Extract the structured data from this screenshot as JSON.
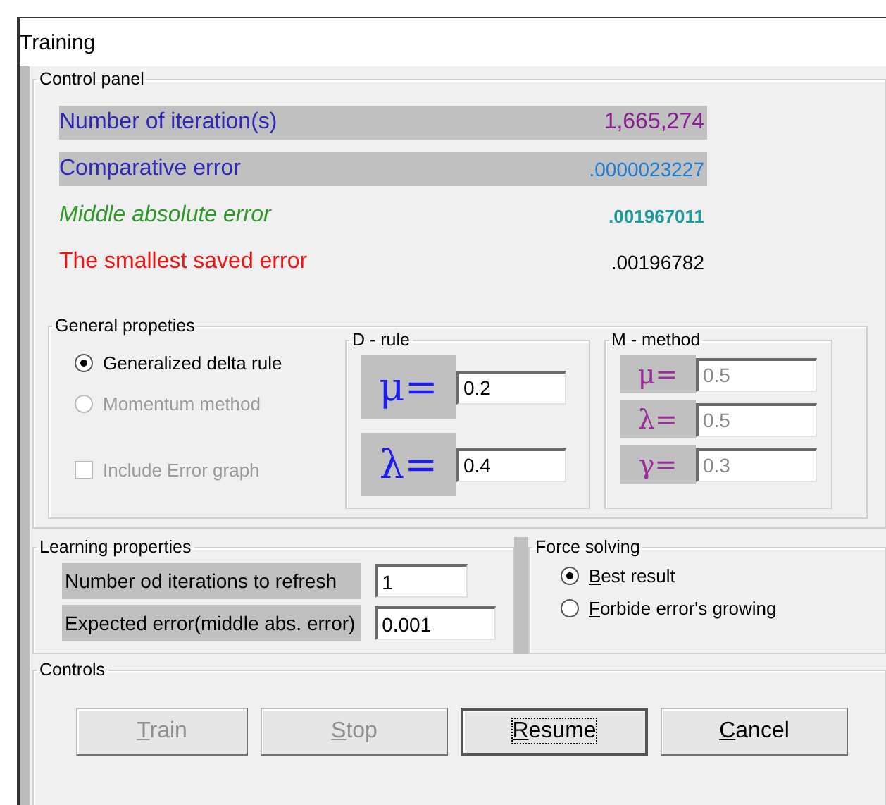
{
  "window": {
    "title": "Training"
  },
  "control_panel": {
    "title": "Control panel",
    "rows": [
      {
        "kind": "iterations",
        "label": "Number of iteration(s)",
        "value": "1,665,274"
      },
      {
        "kind": "comparative",
        "label": "Comparative error",
        "value": ".0000023227"
      },
      {
        "kind": "middle",
        "label": "Middle absolute error",
        "value": ".001967011"
      },
      {
        "kind": "smallest",
        "label": "The smallest saved error",
        "value": ".00196782"
      }
    ]
  },
  "general_properties": {
    "title": "General propeties",
    "options": [
      {
        "label": "Generalized delta rule",
        "selected": true,
        "disabled": false
      },
      {
        "label": "Momentum method",
        "selected": false,
        "disabled": true
      }
    ],
    "error_graph": {
      "label": "Include Error graph",
      "checked": false,
      "disabled": true
    }
  },
  "d_rule": {
    "title": "D - rule",
    "params": [
      {
        "symbol": "μ=",
        "value": "0.2",
        "disabled": false
      },
      {
        "symbol": "λ=",
        "value": "0.4",
        "disabled": false
      }
    ]
  },
  "m_method": {
    "title": "M - method",
    "params": [
      {
        "symbol": "μ=",
        "value": "0.5",
        "disabled": true
      },
      {
        "symbol": "λ=",
        "value": "0.5",
        "disabled": true
      },
      {
        "symbol": "γ=",
        "value": "0.3",
        "disabled": true
      }
    ]
  },
  "learning_properties": {
    "title": "Learning properties",
    "fields": [
      {
        "label": "Number od iterations to refresh",
        "value": "1"
      },
      {
        "label": "Expected error(middle abs. error)",
        "value": "0.001"
      }
    ]
  },
  "force_solving": {
    "title": "Force solving",
    "options": [
      {
        "label": "Best result",
        "selected": true
      },
      {
        "label": "Forbide error's growing",
        "selected": false
      }
    ]
  },
  "controls": {
    "title": "Controls",
    "buttons": [
      {
        "label": "Train",
        "disabled": true,
        "focused": false
      },
      {
        "label": "Stop",
        "disabled": true,
        "focused": false
      },
      {
        "label": "Resume",
        "disabled": false,
        "focused": true
      },
      {
        "label": "Cancel",
        "disabled": false,
        "focused": false
      }
    ]
  }
}
